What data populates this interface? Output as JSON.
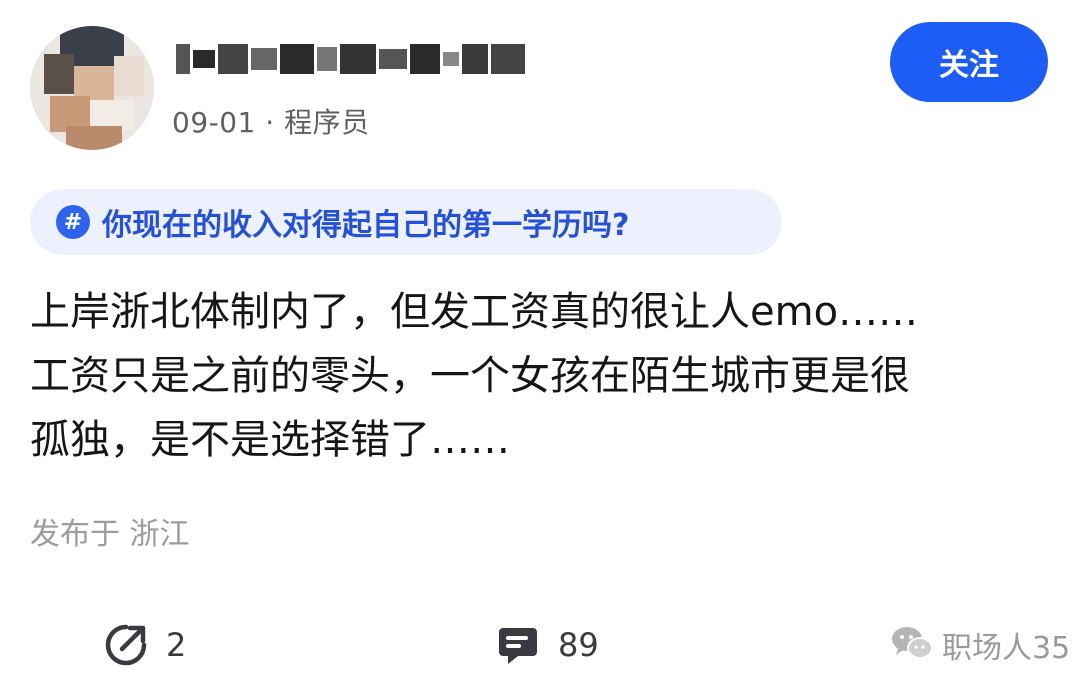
{
  "post": {
    "author": {
      "name_pixelated": true,
      "date": "09-01",
      "separator": "·",
      "role": "程序员"
    },
    "follow_label": "关注",
    "topic": {
      "icon": "#",
      "text": "你现在的收入对得起自己的第一学历吗?"
    },
    "body_lines": [
      "上岸浙北体制内了，但发工资真的很让人emo……",
      "工资只是之前的零头，一个女孩在陌生城市更是很",
      "孤独，是不是选择错了……"
    ],
    "location": "发布于 浙江",
    "actions": {
      "share_count": "2",
      "comment_count": "89"
    },
    "watermark": "职场人35"
  },
  "colors": {
    "accent": "#1d5cf5",
    "topic_bg": "#edf1fd",
    "topic_text": "#2550d8",
    "meta_text": "#5f6066",
    "location_text": "#9b9ca0"
  },
  "icons": {
    "share": "share-arrow-icon",
    "comment": "comment-bubble-icon",
    "watermark": "wechat-icon"
  }
}
